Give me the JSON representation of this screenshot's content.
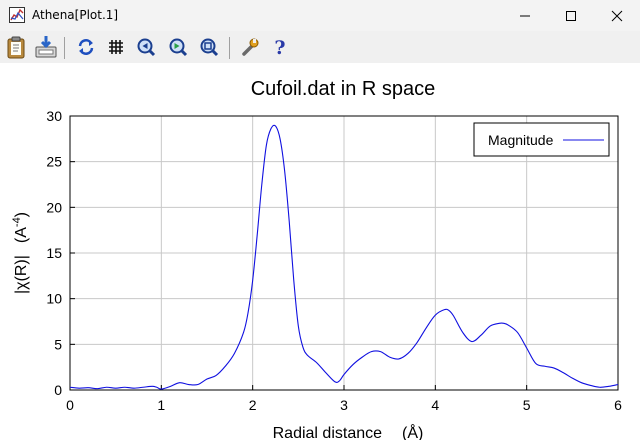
{
  "window": {
    "title": "Athena[Plot.1]"
  },
  "toolbar": {
    "buttons": [
      {
        "icon": "clipboard-icon",
        "tooltip": ""
      },
      {
        "icon": "save-image-icon",
        "tooltip": ""
      },
      {
        "icon": "refresh-icon",
        "tooltip": ""
      },
      {
        "icon": "grid-icon",
        "tooltip": ""
      },
      {
        "icon": "zoom-out-icon",
        "tooltip": ""
      },
      {
        "icon": "zoom-in-icon",
        "tooltip": ""
      },
      {
        "icon": "zoom-reset-icon",
        "tooltip": ""
      },
      {
        "icon": "wrench-icon",
        "tooltip": ""
      },
      {
        "icon": "help-icon",
        "tooltip": ""
      }
    ]
  },
  "colors": {
    "series": "#1010e0",
    "grid": "#c8c8c8",
    "titlebar": "#f3f3f3",
    "toolbar": "#f0f0f0"
  },
  "chart_data": {
    "type": "line",
    "title": "Cufoil.dat in R space",
    "xlabel": "Radial distance",
    "xlabel_unit": "(Å)",
    "ylabel": "|χ(R)|",
    "ylabel_unit_base": "(A",
    "ylabel_unit_exp": "-4",
    "ylabel_unit_close": ")",
    "xlim": [
      0,
      6
    ],
    "ylim": [
      0,
      30
    ],
    "xticks": [
      "0",
      "1",
      "2",
      "3",
      "4",
      "5",
      "6"
    ],
    "yticks": [
      "0",
      "5",
      "10",
      "15",
      "20",
      "25",
      "30"
    ],
    "grid": true,
    "legend_position": "top-right",
    "series": [
      {
        "name": "Magnitude",
        "x": [
          0,
          0.1,
          0.2,
          0.3,
          0.4,
          0.5,
          0.6,
          0.7,
          0.8,
          0.9,
          0.95,
          1.0,
          1.1,
          1.2,
          1.3,
          1.4,
          1.5,
          1.6,
          1.7,
          1.8,
          1.9,
          1.95,
          2.0,
          2.05,
          2.1,
          2.15,
          2.2,
          2.25,
          2.3,
          2.35,
          2.4,
          2.45,
          2.5,
          2.55,
          2.6,
          2.7,
          2.8,
          2.9,
          2.95,
          3.0,
          3.1,
          3.2,
          3.3,
          3.4,
          3.5,
          3.6,
          3.7,
          3.8,
          3.9,
          4.0,
          4.1,
          4.15,
          4.2,
          4.3,
          4.4,
          4.5,
          4.6,
          4.7,
          4.75,
          4.8,
          4.9,
          5.0,
          5.1,
          5.2,
          5.3,
          5.4,
          5.5,
          5.6,
          5.7,
          5.8,
          5.9,
          6.0
        ],
        "y": [
          0.3,
          0.2,
          0.25,
          0.15,
          0.3,
          0.2,
          0.3,
          0.2,
          0.3,
          0.4,
          0.3,
          0.1,
          0.4,
          0.8,
          0.6,
          0.6,
          1.2,
          1.6,
          2.6,
          4.0,
          6.3,
          8.5,
          12.0,
          17.0,
          22.5,
          26.8,
          28.6,
          28.9,
          27.5,
          24.0,
          18.5,
          12.0,
          7.0,
          4.7,
          3.8,
          3.0,
          1.9,
          0.9,
          1.0,
          1.7,
          2.8,
          3.6,
          4.2,
          4.2,
          3.6,
          3.4,
          4.0,
          5.2,
          6.8,
          8.2,
          8.8,
          8.7,
          8.1,
          6.3,
          5.3,
          6.0,
          7.0,
          7.3,
          7.3,
          7.1,
          6.3,
          4.6,
          2.9,
          2.6,
          2.4,
          1.9,
          1.3,
          0.8,
          0.5,
          0.3,
          0.4,
          0.6
        ]
      }
    ]
  }
}
